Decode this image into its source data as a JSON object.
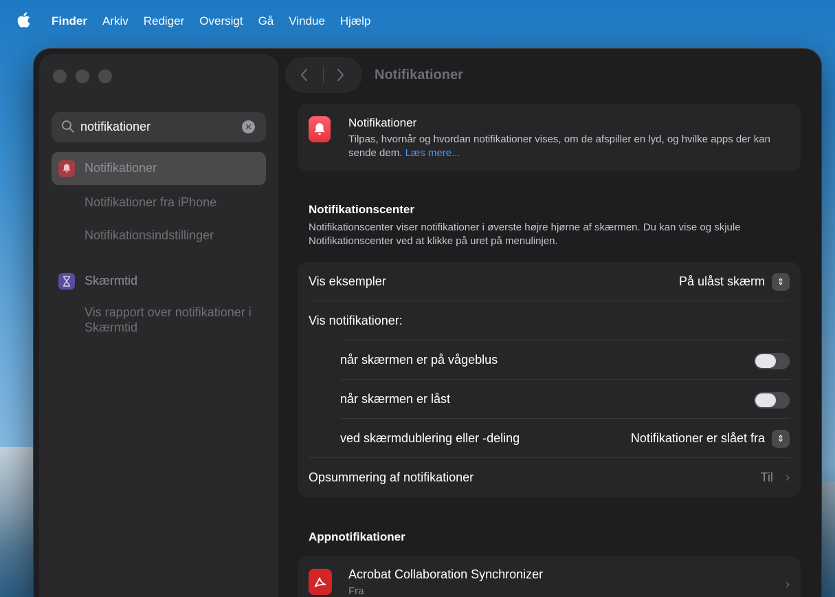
{
  "menubar": {
    "apple_icon": "apple-logo-icon",
    "items": [
      "Finder",
      "Arkiv",
      "Rediger",
      "Oversigt",
      "Gå",
      "Vindue",
      "Hjælp"
    ]
  },
  "sidebar": {
    "search": {
      "value": "notifikationer"
    },
    "items": [
      {
        "label": "Notifikationer",
        "icon": "bell-icon",
        "selected": true
      },
      {
        "label": "Notifikationer fra iPhone"
      },
      {
        "label": "Notifikationsindstillinger"
      },
      {
        "label": "Skærmtid",
        "icon": "hourglass-icon"
      },
      {
        "label": "Vis rapport over notifikationer i Skærmtid"
      }
    ]
  },
  "main": {
    "title": "Notifikationer",
    "header": {
      "title": "Notifikationer",
      "desc": "Tilpas, hvornår og hvordan notifikationer vises, om de afspiller en lyd, og hvilke apps der kan sende dem.",
      "link": "Læs mere..."
    },
    "notification_center": {
      "title": "Notifikationscenter",
      "desc": "Notifikationscenter viser notifikationer i øverste højre hjørne af skærmen. Du kan vise og skjule Notifikationscenter ved at klikke på uret på menulinjen."
    },
    "rows": {
      "vis_eksempler": {
        "label": "Vis eksempler",
        "value": "På ulåst skærm"
      },
      "vis_notifikationer": {
        "label": "Vis notifikationer:"
      },
      "vaageblus": {
        "label": "når skærmen er på vågeblus",
        "on": false
      },
      "laast": {
        "label": "når skærmen er låst",
        "on": false
      },
      "dublering": {
        "label": "ved skærmdublering eller -deling",
        "value": "Notifikationer er slået fra"
      },
      "opsummering": {
        "label": "Opsummering af notifikationer",
        "value": "Til"
      }
    },
    "app_notifications": {
      "title": "Appnotifikationer",
      "apps": [
        {
          "name": "Acrobat Collaboration Synchronizer",
          "status": "Fra"
        }
      ]
    }
  },
  "colors": {
    "accent_link": "#3d9cff",
    "bell_icon_bg": "#e8323e",
    "acrobat_bg": "#d42526",
    "screentime_icon_bg": "#5a4c9e"
  }
}
